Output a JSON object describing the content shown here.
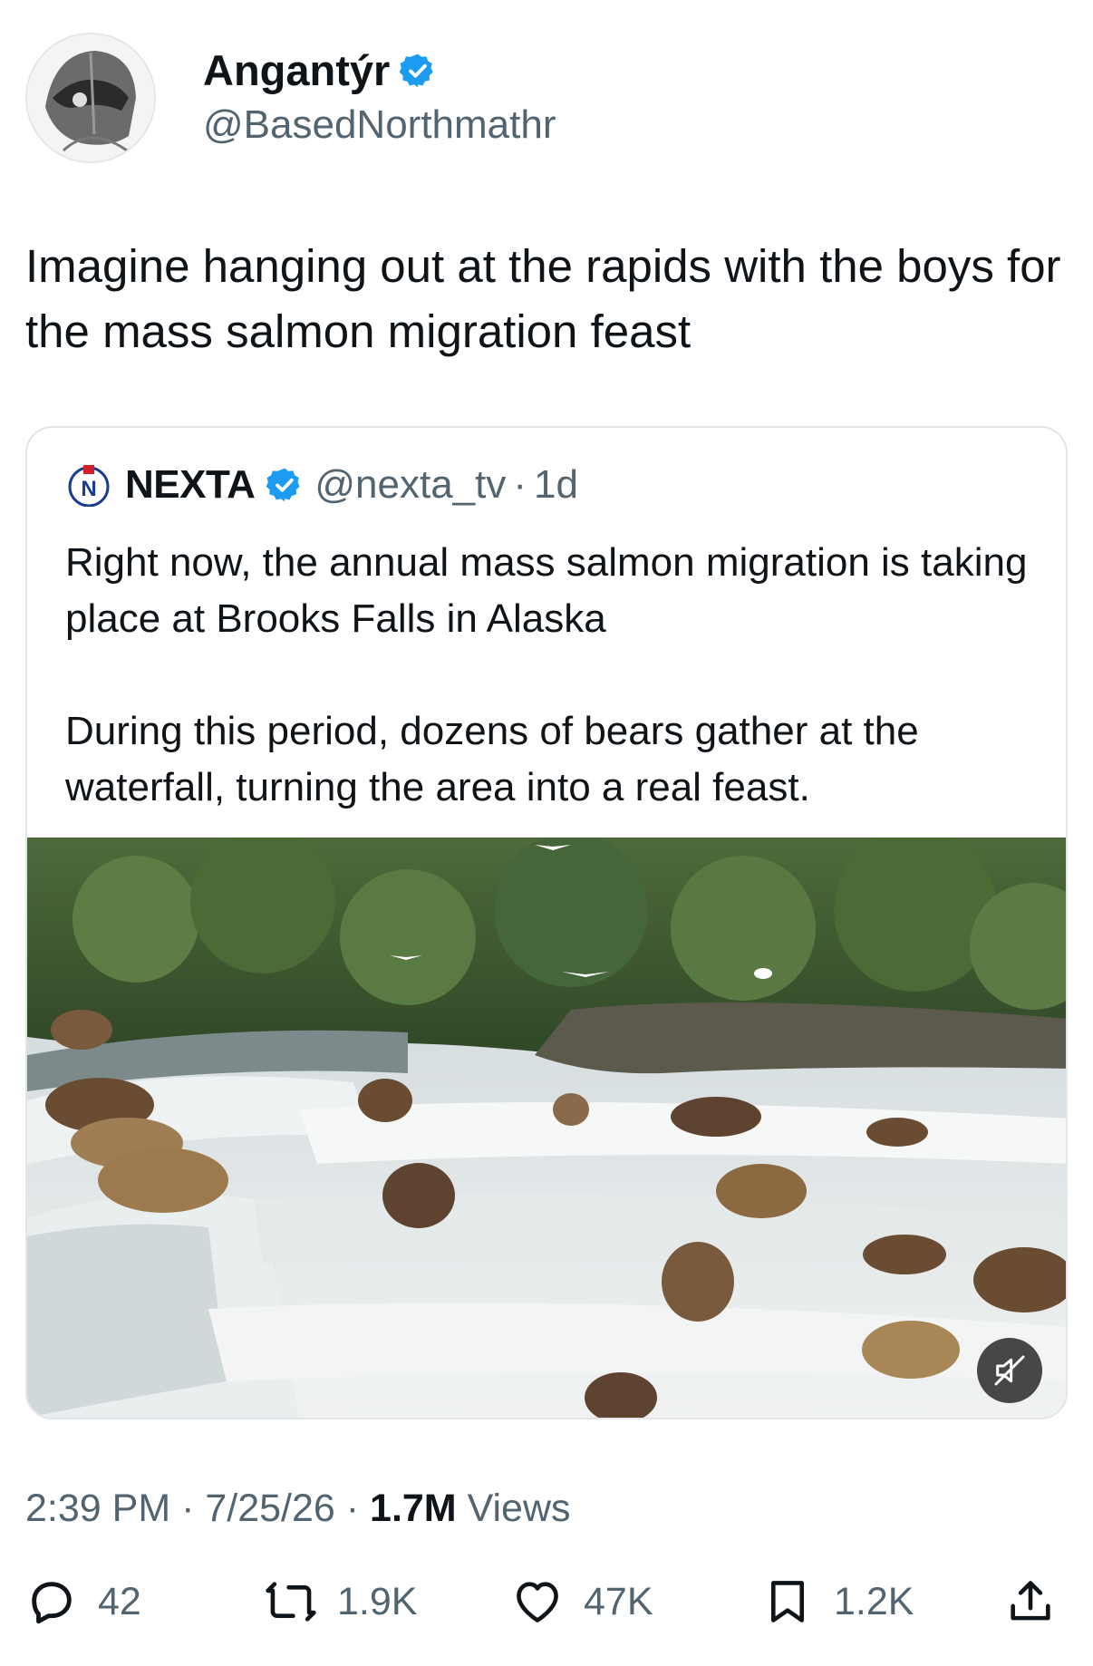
{
  "tweet": {
    "display_name": "Angantýr",
    "handle": "@BasedNorthmathr",
    "text": "Imagine hanging out at the rapids with the boys for the mass salmon migration feast",
    "timestamp": "2:39 PM · 7/25/26 · ",
    "views_count": "1.7M",
    "views_label": " Views"
  },
  "quote": {
    "display_name": "NEXTA",
    "handle": "@nexta_tv",
    "separator": "·",
    "time": "1d",
    "paragraph1": "Right now, the annual mass salmon migration is taking place at Brooks Falls in Alaska",
    "paragraph2": "During this period, dozens of bears gather at the waterfall, turning the area into a real feast.",
    "media": {
      "type": "video",
      "muted": true
    }
  },
  "actions": {
    "replies": "42",
    "reposts": "1.9K",
    "likes": "47K",
    "bookmarks": "1.2K"
  },
  "colors": {
    "verified": "#1d9bf0",
    "secondary_text": "#536471",
    "primary_text": "#0f1419",
    "border": "#e1e5e9"
  },
  "icons": [
    "verified-badge-icon",
    "nexta-logo-icon",
    "mute-icon",
    "reply-icon",
    "repost-icon",
    "like-icon",
    "bookmark-icon",
    "share-icon"
  ]
}
